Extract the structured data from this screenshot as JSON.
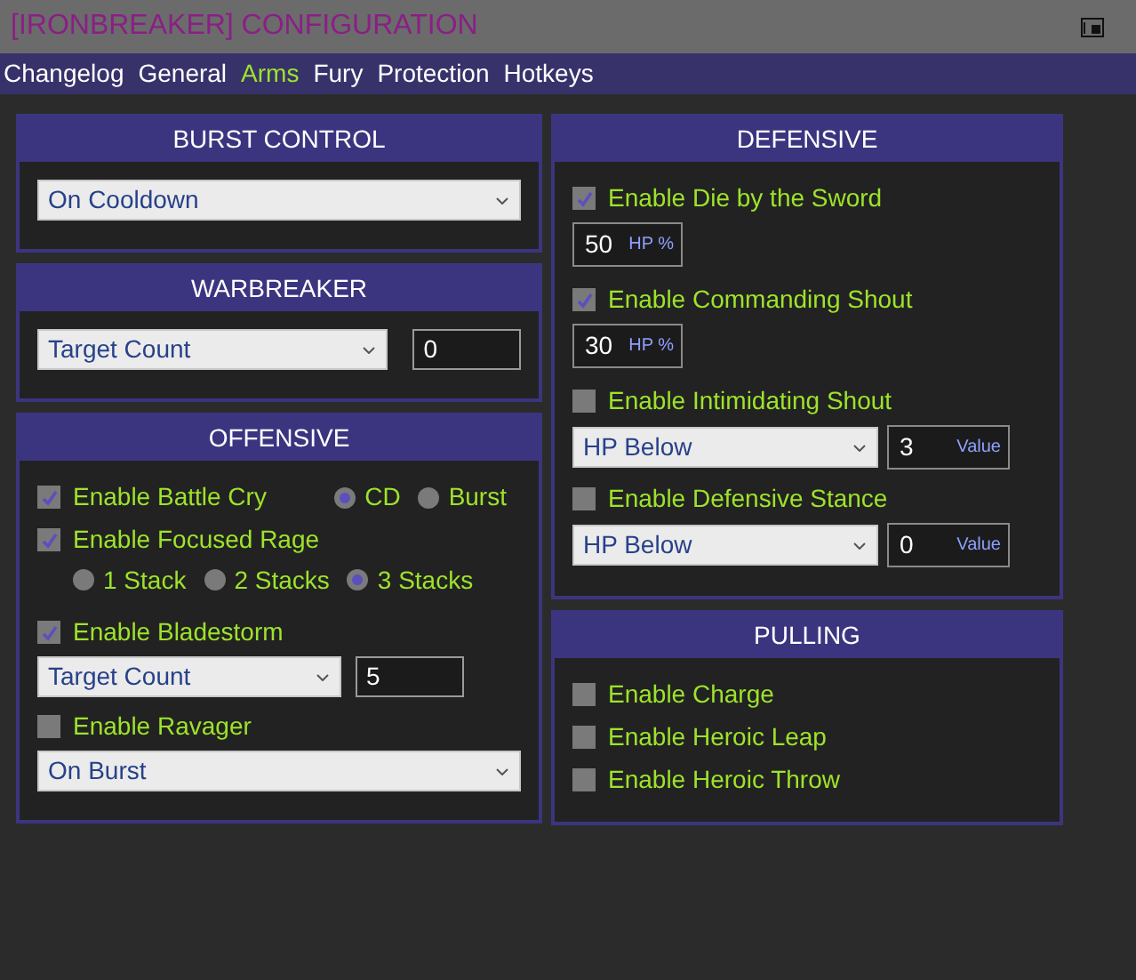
{
  "window": {
    "title": "[IRONBREAKER] CONFIGURATION"
  },
  "tabs": [
    {
      "label": "Changelog",
      "selected": false
    },
    {
      "label": "General",
      "selected": false
    },
    {
      "label": "Arms",
      "selected": true
    },
    {
      "label": "Fury",
      "selected": false
    },
    {
      "label": "Protection",
      "selected": false
    },
    {
      "label": "Hotkeys",
      "selected": false
    }
  ],
  "columns": [
    {
      "panels": [
        {
          "title": "BURST CONTROL",
          "rows": [
            {
              "kind": "select",
              "value": "On Cooldown"
            }
          ]
        },
        {
          "title": "WARBREAKER",
          "rows": [
            {
              "kind": "select_number",
              "value": "Target Count",
              "number": "0"
            }
          ]
        },
        {
          "title": "OFFENSIVE",
          "rows": [
            {
              "kind": "checkbox",
              "label": "Enable Battle Cry",
              "checked": true,
              "options": [
                {
                  "label": "CD",
                  "selected": true
                },
                {
                  "label": "Burst",
                  "selected": false
                }
              ]
            },
            {
              "kind": "checkbox",
              "label": "Enable Focused Rage",
              "checked": true
            },
            {
              "kind": "radios",
              "options": [
                {
                  "label": "1 Stack",
                  "selected": false
                },
                {
                  "label": "2 Stacks",
                  "selected": false
                },
                {
                  "label": "3 Stacks",
                  "selected": true
                }
              ]
            },
            {
              "kind": "checkbox",
              "label": "Enable Bladestorm",
              "checked": true
            },
            {
              "kind": "select_number",
              "value": "Target Count",
              "number": "5"
            },
            {
              "kind": "checkbox",
              "label": "Enable Ravager",
              "checked": false
            },
            {
              "kind": "select",
              "value": "On Burst"
            }
          ]
        }
      ]
    },
    {
      "panels": [
        {
          "title": "DEFENSIVE",
          "rows": [
            {
              "kind": "checkbox",
              "label": "Enable Die by the Sword",
              "checked": true
            },
            {
              "kind": "number_unit",
              "number": "50",
              "unit": "HP %"
            },
            {
              "kind": "checkbox",
              "label": "Enable Commanding Shout",
              "checked": true
            },
            {
              "kind": "number_unit",
              "number": "30",
              "unit": "HP %"
            },
            {
              "kind": "checkbox",
              "label": "Enable Intimidating Shout",
              "checked": false
            },
            {
              "kind": "select_value",
              "value": "HP Below",
              "number": "3",
              "unit": "Value"
            },
            {
              "kind": "checkbox",
              "label": "Enable Defensive Stance",
              "checked": false
            },
            {
              "kind": "select_value",
              "value": "HP Below",
              "number": "0",
              "unit": "Value"
            }
          ]
        },
        {
          "title": "PULLING",
          "rows": [
            {
              "kind": "checkbox",
              "label": "Enable Charge",
              "checked": false
            },
            {
              "kind": "checkbox",
              "label": "Enable Heroic Leap",
              "checked": false
            },
            {
              "kind": "checkbox",
              "label": "Enable Heroic Throw",
              "checked": false
            }
          ]
        }
      ]
    }
  ]
}
